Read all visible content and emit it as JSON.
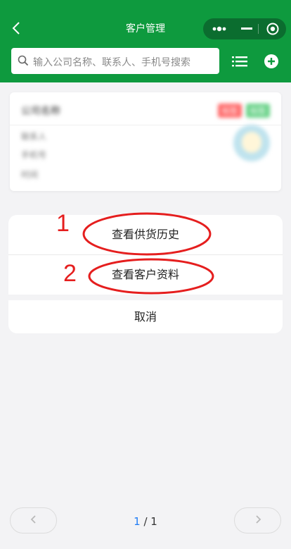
{
  "header": {
    "title": "客户管理",
    "back_icon": "chevron-left-icon",
    "capsule": {
      "more_icon": "more-dots-icon",
      "minimize_icon": "minimize-icon",
      "close_icon": "target-close-icon"
    }
  },
  "search": {
    "placeholder": "输入公司名称、联系人、手机号搜索",
    "icon": "search-icon"
  },
  "toolbar": {
    "list_icon": "list-icon",
    "add_icon": "add-circle-icon"
  },
  "customer_card": {
    "company_name": "公司名称",
    "tags": [
      "标签",
      "标签"
    ],
    "contact_line": "联系人",
    "phone_line": "手机号",
    "time_line": "时间"
  },
  "action_sheet": {
    "options": [
      "查看供货历史",
      "查看客户资料"
    ],
    "cancel_label": "取消"
  },
  "annotations": {
    "marker1": "1",
    "marker2": "2",
    "color": "#e51e1e"
  },
  "pagination": {
    "current": "1",
    "separator": " / ",
    "total": "1",
    "prev_icon": "chevron-left-icon",
    "next_icon": "chevron-right-icon"
  },
  "colors": {
    "header_bg": "#0e9a3e",
    "accent_blue": "#1f7cf5"
  }
}
